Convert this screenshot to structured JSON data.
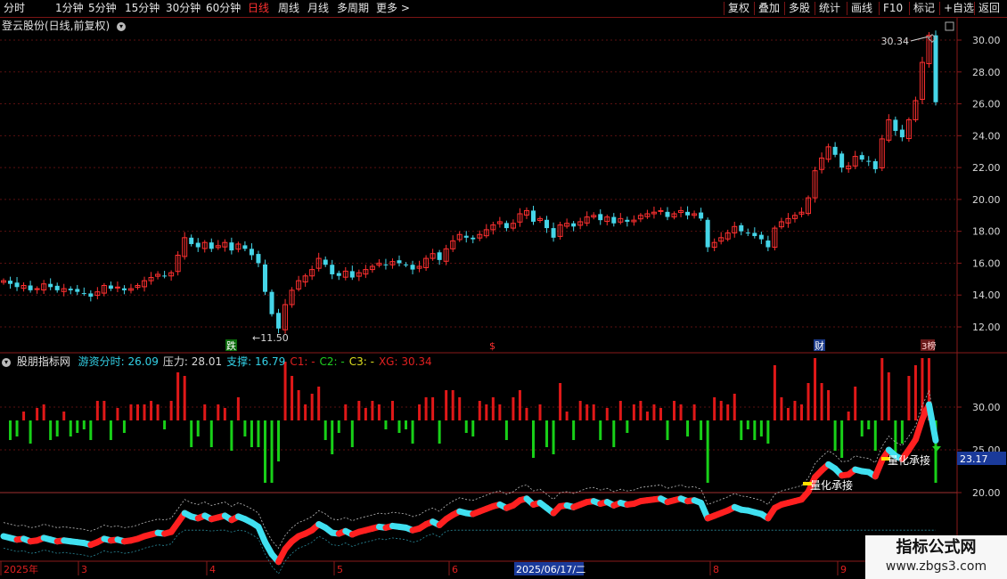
{
  "toolbar": {
    "periods": [
      "分时",
      "1分钟",
      "5分钟",
      "15分钟",
      "30分钟",
      "60分钟",
      "日线",
      "周线",
      "月线",
      "多周期",
      "更多 >"
    ],
    "active_period": "日线",
    "right_buttons": [
      "复权",
      "叠加",
      "多股",
      "统计",
      "画线",
      "F10",
      "标记",
      "+自选",
      "返回"
    ]
  },
  "main_chart": {
    "title": "登云股份(日线,前复权)",
    "high_label": "30.34",
    "low_label": "11.50",
    "markers": [
      "跌",
      "$",
      "财",
      "榜"
    ],
    "y_ticks": [
      "30.00",
      "28.00",
      "26.00",
      "24.00",
      "22.00",
      "20.00",
      "18.00",
      "16.00",
      "14.00",
      "12.00"
    ]
  },
  "indicator": {
    "name": "股朋指标网",
    "items": [
      {
        "label": "游资分时:",
        "value": "26.09",
        "color": "#33d0e6"
      },
      {
        "label": "压力:",
        "value": "28.01",
        "color": "#d8d8d8"
      },
      {
        "label": "支撑:",
        "value": "16.79",
        "color": "#33d0e6"
      },
      {
        "label": "C1:",
        "value": "-",
        "color": "#e02020"
      },
      {
        "label": "C2:",
        "value": "-",
        "color": "#20d020"
      },
      {
        "label": "C3:",
        "value": "-",
        "color": "#e0e020"
      },
      {
        "label": "XG:",
        "value": "30.34",
        "color": "#e02020"
      }
    ],
    "y_ticks": [
      "30.00",
      "25.00",
      "20.00"
    ],
    "current_value": "23.17",
    "annotations": [
      "量化承接",
      "量化承接"
    ]
  },
  "x_axis": {
    "labels": [
      "2025年",
      "3",
      "4",
      "5",
      "6",
      "8",
      "9"
    ],
    "cursor_date": "2025/06/17/二"
  },
  "watermark": {
    "line1": "指标公式网",
    "line2": "www.zbgs3.com"
  },
  "chart_data": {
    "type": "candlestick",
    "title": "登云股份(日线,前复权)",
    "ylim": [
      11,
      31
    ],
    "close_series": [
      14.9,
      14.7,
      14.5,
      14.6,
      14.3,
      14.4,
      14.7,
      14.5,
      14.3,
      14.4,
      14.3,
      14.2,
      14.1,
      13.9,
      14.2,
      14.6,
      14.4,
      14.5,
      14.3,
      14.4,
      14.6,
      14.9,
      15.1,
      15.3,
      15.2,
      15.4,
      16.5,
      17.6,
      17.2,
      17.0,
      17.3,
      16.9,
      17.1,
      17.3,
      16.8,
      17.2,
      16.9,
      16.5,
      16.0,
      14.2,
      12.8,
      11.9,
      13.4,
      14.3,
      14.9,
      15.2,
      15.6,
      16.3,
      15.9,
      15.3,
      15.2,
      15.5,
      15.1,
      15.4,
      15.6,
      15.8,
      16.0,
      15.9,
      16.1,
      16.0,
      15.9,
      15.6,
      15.8,
      16.3,
      16.6,
      16.2,
      16.9,
      17.4,
      17.8,
      17.6,
      17.5,
      17.8,
      18.1,
      18.4,
      18.6,
      18.2,
      18.5,
      19.1,
      19.3,
      18.6,
      18.8,
      18.2,
      17.6,
      18.4,
      18.5,
      18.3,
      18.6,
      18.9,
      19.0,
      18.7,
      18.9,
      18.5,
      18.8,
      18.6,
      18.7,
      19.0,
      19.1,
      19.2,
      19.3,
      18.9,
      19.1,
      19.3,
      19.0,
      19.1,
      18.8,
      17.0,
      17.3,
      17.6,
      17.9,
      18.3,
      18.0,
      17.9,
      17.7,
      17.5,
      17.0,
      18.2,
      18.6,
      18.8,
      19.0,
      19.2,
      20.1,
      21.8,
      22.6,
      23.3,
      22.8,
      22.0,
      22.1,
      22.7,
      22.5,
      22.4,
      21.9,
      23.8,
      25.0,
      24.3,
      23.9,
      25.0,
      26.2,
      28.6,
      30.3,
      26.1
    ],
    "series": [
      {
        "name": "游资分时",
        "values": [
          26.09
        ]
      },
      {
        "name": "压力",
        "values": [
          28.01
        ]
      },
      {
        "name": "支撑",
        "values": [
          16.79
        ]
      },
      {
        "name": "XG",
        "values": [
          30.34
        ]
      }
    ]
  }
}
